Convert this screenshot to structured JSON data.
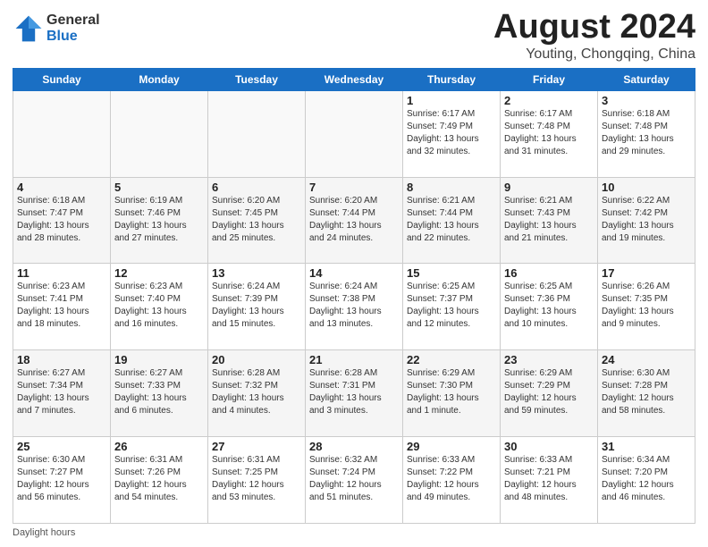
{
  "logo": {
    "general": "General",
    "blue": "Blue"
  },
  "title": {
    "month": "August 2024",
    "location": "Youting, Chongqing, China"
  },
  "days_header": [
    "Sunday",
    "Monday",
    "Tuesday",
    "Wednesday",
    "Thursday",
    "Friday",
    "Saturday"
  ],
  "footer": "Daylight hours",
  "weeks": [
    [
      {
        "day": "",
        "info": ""
      },
      {
        "day": "",
        "info": ""
      },
      {
        "day": "",
        "info": ""
      },
      {
        "day": "",
        "info": ""
      },
      {
        "day": "1",
        "info": "Sunrise: 6:17 AM\nSunset: 7:49 PM\nDaylight: 13 hours\nand 32 minutes."
      },
      {
        "day": "2",
        "info": "Sunrise: 6:17 AM\nSunset: 7:48 PM\nDaylight: 13 hours\nand 31 minutes."
      },
      {
        "day": "3",
        "info": "Sunrise: 6:18 AM\nSunset: 7:48 PM\nDaylight: 13 hours\nand 29 minutes."
      }
    ],
    [
      {
        "day": "4",
        "info": "Sunrise: 6:18 AM\nSunset: 7:47 PM\nDaylight: 13 hours\nand 28 minutes."
      },
      {
        "day": "5",
        "info": "Sunrise: 6:19 AM\nSunset: 7:46 PM\nDaylight: 13 hours\nand 27 minutes."
      },
      {
        "day": "6",
        "info": "Sunrise: 6:20 AM\nSunset: 7:45 PM\nDaylight: 13 hours\nand 25 minutes."
      },
      {
        "day": "7",
        "info": "Sunrise: 6:20 AM\nSunset: 7:44 PM\nDaylight: 13 hours\nand 24 minutes."
      },
      {
        "day": "8",
        "info": "Sunrise: 6:21 AM\nSunset: 7:44 PM\nDaylight: 13 hours\nand 22 minutes."
      },
      {
        "day": "9",
        "info": "Sunrise: 6:21 AM\nSunset: 7:43 PM\nDaylight: 13 hours\nand 21 minutes."
      },
      {
        "day": "10",
        "info": "Sunrise: 6:22 AM\nSunset: 7:42 PM\nDaylight: 13 hours\nand 19 minutes."
      }
    ],
    [
      {
        "day": "11",
        "info": "Sunrise: 6:23 AM\nSunset: 7:41 PM\nDaylight: 13 hours\nand 18 minutes."
      },
      {
        "day": "12",
        "info": "Sunrise: 6:23 AM\nSunset: 7:40 PM\nDaylight: 13 hours\nand 16 minutes."
      },
      {
        "day": "13",
        "info": "Sunrise: 6:24 AM\nSunset: 7:39 PM\nDaylight: 13 hours\nand 15 minutes."
      },
      {
        "day": "14",
        "info": "Sunrise: 6:24 AM\nSunset: 7:38 PM\nDaylight: 13 hours\nand 13 minutes."
      },
      {
        "day": "15",
        "info": "Sunrise: 6:25 AM\nSunset: 7:37 PM\nDaylight: 13 hours\nand 12 minutes."
      },
      {
        "day": "16",
        "info": "Sunrise: 6:25 AM\nSunset: 7:36 PM\nDaylight: 13 hours\nand 10 minutes."
      },
      {
        "day": "17",
        "info": "Sunrise: 6:26 AM\nSunset: 7:35 PM\nDaylight: 13 hours\nand 9 minutes."
      }
    ],
    [
      {
        "day": "18",
        "info": "Sunrise: 6:27 AM\nSunset: 7:34 PM\nDaylight: 13 hours\nand 7 minutes."
      },
      {
        "day": "19",
        "info": "Sunrise: 6:27 AM\nSunset: 7:33 PM\nDaylight: 13 hours\nand 6 minutes."
      },
      {
        "day": "20",
        "info": "Sunrise: 6:28 AM\nSunset: 7:32 PM\nDaylight: 13 hours\nand 4 minutes."
      },
      {
        "day": "21",
        "info": "Sunrise: 6:28 AM\nSunset: 7:31 PM\nDaylight: 13 hours\nand 3 minutes."
      },
      {
        "day": "22",
        "info": "Sunrise: 6:29 AM\nSunset: 7:30 PM\nDaylight: 13 hours\nand 1 minute."
      },
      {
        "day": "23",
        "info": "Sunrise: 6:29 AM\nSunset: 7:29 PM\nDaylight: 12 hours\nand 59 minutes."
      },
      {
        "day": "24",
        "info": "Sunrise: 6:30 AM\nSunset: 7:28 PM\nDaylight: 12 hours\nand 58 minutes."
      }
    ],
    [
      {
        "day": "25",
        "info": "Sunrise: 6:30 AM\nSunset: 7:27 PM\nDaylight: 12 hours\nand 56 minutes."
      },
      {
        "day": "26",
        "info": "Sunrise: 6:31 AM\nSunset: 7:26 PM\nDaylight: 12 hours\nand 54 minutes."
      },
      {
        "day": "27",
        "info": "Sunrise: 6:31 AM\nSunset: 7:25 PM\nDaylight: 12 hours\nand 53 minutes."
      },
      {
        "day": "28",
        "info": "Sunrise: 6:32 AM\nSunset: 7:24 PM\nDaylight: 12 hours\nand 51 minutes."
      },
      {
        "day": "29",
        "info": "Sunrise: 6:33 AM\nSunset: 7:22 PM\nDaylight: 12 hours\nand 49 minutes."
      },
      {
        "day": "30",
        "info": "Sunrise: 6:33 AM\nSunset: 7:21 PM\nDaylight: 12 hours\nand 48 minutes."
      },
      {
        "day": "31",
        "info": "Sunrise: 6:34 AM\nSunset: 7:20 PM\nDaylight: 12 hours\nand 46 minutes."
      }
    ]
  ]
}
